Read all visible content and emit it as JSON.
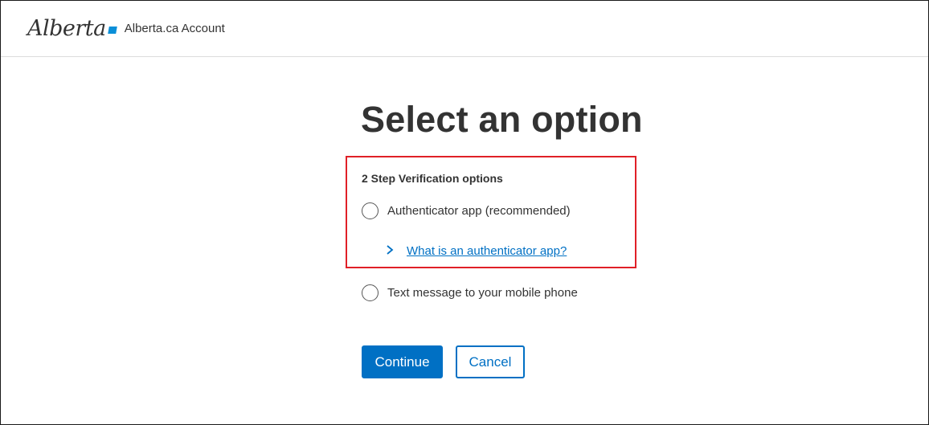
{
  "header": {
    "logo_text": "Alberta",
    "title": "Alberta.ca Account"
  },
  "page": {
    "title": "Select an option"
  },
  "verification": {
    "group_label": "2 Step Verification options",
    "options": [
      {
        "label": "Authenticator app (recommended)",
        "selected": false
      },
      {
        "label": "Text message to your mobile phone",
        "selected": false
      }
    ],
    "help_link": "What is an authenticator app?"
  },
  "actions": {
    "continue_label": "Continue",
    "cancel_label": "Cancel"
  },
  "colors": {
    "brand_blue": "#0070c4",
    "logo_accent": "#0a8fd8",
    "highlight_red": "#e02027",
    "text": "#333333"
  },
  "icons": {
    "help_chevron": "chevron-right-icon",
    "logo_mark": "alberta-logo-mark"
  }
}
